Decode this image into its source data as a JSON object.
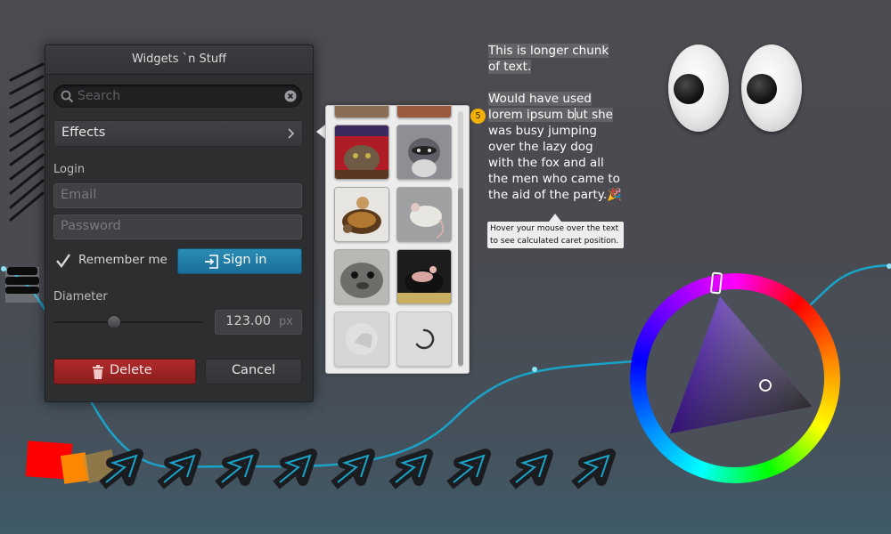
{
  "window": {
    "title": "Widgets `n Stuff",
    "search_placeholder": "Search",
    "effects_label": "Effects",
    "login_label": "Login",
    "email_placeholder": "Email",
    "password_placeholder": "Password",
    "remember_label": "Remember me",
    "remember_checked": true,
    "signin_label": "Sign in",
    "diameter_label": "Diameter",
    "diameter_slider_fraction": 0.4,
    "diameter_value": "123.00",
    "diameter_unit": "px",
    "delete_label": "Delete",
    "cancel_label": "Cancel"
  },
  "image_grid": {
    "images": [
      {
        "name": "cat-under-blanket",
        "kind": "photo"
      },
      {
        "name": "raccoon",
        "kind": "photo"
      },
      {
        "name": "turtle-with-mouse",
        "kind": "photo"
      },
      {
        "name": "mouse",
        "kind": "photo"
      },
      {
        "name": "seal",
        "kind": "photo"
      },
      {
        "name": "guinea-pig",
        "kind": "photo"
      },
      {
        "name": "loading-placeholder",
        "kind": "loading"
      },
      {
        "name": "loading-spinner",
        "kind": "loading"
      }
    ]
  },
  "text_block": {
    "paragraph1": "This is longer chunk of text.",
    "p2_before_caret": "Would have used lorem ipsum b",
    "p2_after_caret": "ut she",
    "p2_rest": "was busy jumping over the lazy dog with the fox and all the men who came to the aid of the party.",
    "emoji": "🎉",
    "caret_badge": "5",
    "tooltip": "Hover your mouse over the text to see calculated caret position."
  },
  "colors": {
    "signin_blue": "#1f7ea8",
    "delete_red": "#9e2424",
    "curve_cyan": "#1aa3c8",
    "badge_yellow": "#f2b100"
  }
}
